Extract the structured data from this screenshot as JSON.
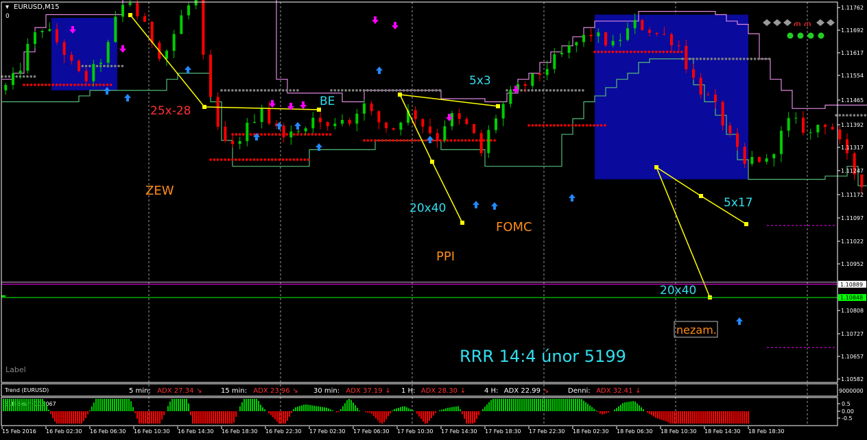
{
  "window": {
    "title": "EURUSD,M15",
    "title_marker": "0",
    "label_text": "Label"
  },
  "colors": {
    "background": "#000000",
    "axis": "#ffffff",
    "grid": "#ffffff",
    "bull": "#00cc00",
    "bear": "#ff0000",
    "box": "#0a0a9c",
    "trend_upper": "#dd88dd",
    "trend_lower": "#55bb77",
    "zigzag": "#ffff00",
    "bid_line": "#ff00ff",
    "ask_line": "#00ff00",
    "cyan_text": "#33ddee",
    "orange_text": "#ff8c1a",
    "red_text": "#ff3030",
    "up_arrow": "#2288ff",
    "down_arrow": "#ff00ff",
    "diamond": "#808080"
  },
  "price_axis": {
    "ticks": [
      "1.11762",
      "1.11692",
      "1.11617",
      "1.11554",
      "1.11465",
      "1.11392",
      "1.11317",
      "1.11247",
      "1.11172",
      "1.11097",
      "1.11022",
      "1.10952",
      "1.10808",
      "1.10727",
      "1.10657",
      "1.10582"
    ],
    "bid_label": "1.10889",
    "ask_label": "1.10848"
  },
  "time_axis": {
    "ticks": [
      "15 Feb 2016",
      "16 Feb 02:30",
      "16 Feb 06:30",
      "16 Feb 10:30",
      "16 Feb 14:30",
      "16 Feb 18:30",
      "16 Feb 22:30",
      "17 Feb 02:30",
      "17 Feb 06:30",
      "17 Feb 10:30",
      "17 Feb 14:30",
      "17 Feb 18:30",
      "17 Feb 22:30",
      "18 Feb 02:30",
      "18 Feb 06:30",
      "18 Feb 10:30",
      "18 Feb 14:30",
      "18 Feb 18:30"
    ]
  },
  "annotations": {
    "a1": "25x-28",
    "a2": "BE",
    "a3": "5x3",
    "a4": "ZEW",
    "a5": "20x40",
    "a6": "FOMC",
    "a7": "PPI",
    "a8": "5x17",
    "a9": "20x40",
    "a10": "nezam.",
    "a11": "RRR 14:4  únor 5199"
  },
  "trend_panel": {
    "name": "Trend (EURUSD)",
    "scale": "9000000",
    "items": [
      {
        "tf": "5 min:",
        "adx": "ADX 27.34",
        "arrow": "↘"
      },
      {
        "tf": "15 min:",
        "adx": "ADX 23.96",
        "arrow": "↘"
      },
      {
        "tf": "30 min:",
        "adx": "ADX 37.19",
        "arrow": "↓"
      },
      {
        "tf": "1 H:",
        "adx": "ADX 28.30",
        "arrow": "↓"
      },
      {
        "tf": "4 H:",
        "adx": "ADX 22.99",
        "arrow": "↘"
      },
      {
        "tf": "Denni:",
        "adx": "ADX 32.41",
        "arrow": "↓"
      }
    ]
  },
  "indicator_panel": {
    "name": "Bull-Bear -0.18067",
    "ticks": [
      "0.5",
      "0.00",
      "-0.5"
    ]
  },
  "chart_data": {
    "type": "candlestick",
    "title": "EURUSD,M15",
    "y_range": [
      1.1052,
      1.1181
    ],
    "candles_count": 210,
    "bid": 1.10889,
    "ask": 1.10848,
    "boxes_time_ranges_hours": [
      [
        4.5,
        10.5
      ],
      [
        54,
        68
      ],
      [
        98,
        107
      ]
    ],
    "zigzag_legs": [
      {
        "label": "25x-28"
      },
      {
        "label": "20x40"
      },
      {
        "label": "5x3"
      },
      {
        "label": "5x17"
      },
      {
        "label": "20x40"
      }
    ]
  }
}
